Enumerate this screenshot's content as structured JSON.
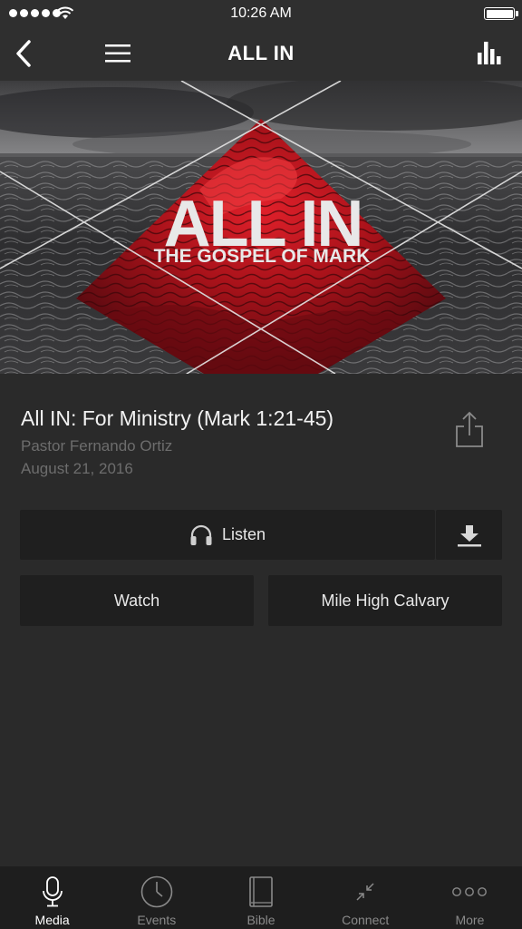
{
  "status_bar": {
    "time": "10:26 AM",
    "signal_icon": "signal-dots-icon",
    "wifi_icon": "wifi-icon",
    "battery_icon": "battery-icon",
    "battery_level": 1.0
  },
  "nav": {
    "title": "ALL IN",
    "back_icon": "chevron-left-icon",
    "menu_icon": "hamburger-menu-icon",
    "stats_icon": "bar-chart-icon"
  },
  "hero": {
    "headline": "ALL IN",
    "subheadline": "THE GOSPEL OF MARK"
  },
  "sermon": {
    "title": "All IN: For Ministry (Mark 1:21-45)",
    "speaker": "Pastor Fernando Ortiz",
    "date": "August 21, 2016",
    "share_icon": "share-icon"
  },
  "actions": {
    "listen_label": "Listen",
    "listen_icon": "headphones-icon",
    "download_icon": "download-icon",
    "watch_label": "Watch",
    "calvary_label": "Mile High Calvary"
  },
  "tabs": [
    {
      "label": "Media",
      "icon": "microphone-icon",
      "active": true
    },
    {
      "label": "Events",
      "icon": "clock-icon",
      "active": false
    },
    {
      "label": "Bible",
      "icon": "book-icon",
      "active": false
    },
    {
      "label": "Connect",
      "icon": "compress-arrows-icon",
      "active": false
    },
    {
      "label": "More",
      "icon": "more-dots-icon",
      "active": false
    }
  ],
  "colors": {
    "background": "#2a2a2a",
    "bar": "#2f2f2f",
    "button": "#1f1f1f",
    "tab_bar": "#1e1e1e",
    "accent_red": "#b3121c",
    "muted_text": "#6d6d6d"
  }
}
